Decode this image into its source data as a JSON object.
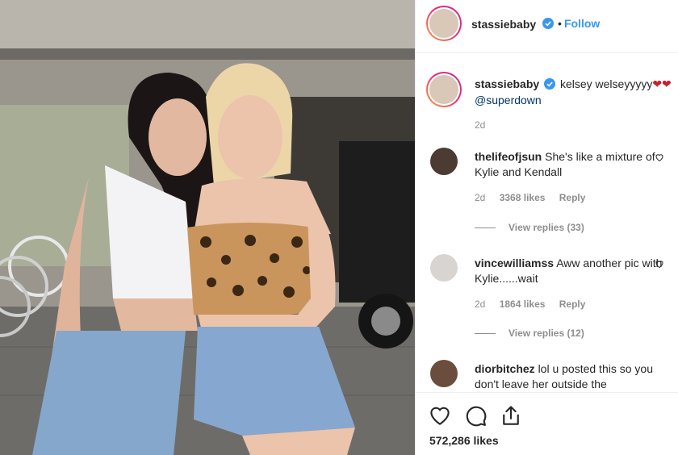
{
  "post": {
    "author": "stassiebaby",
    "follow_label": "Follow",
    "separator": "•",
    "caption": {
      "author": "stassiebaby",
      "text": "kelsey welseyyyyy",
      "hearts": "❤❤",
      "mention": "@superdown",
      "time": "2d"
    },
    "likes": "572,286 likes"
  },
  "comments": [
    {
      "user": "thelifeofjsun",
      "text": "She's like a mixture of Kylie and Kendall",
      "time": "2d",
      "likes": "3368 likes",
      "reply": "Reply",
      "view_replies": "View replies (33)"
    },
    {
      "user": "vincewilliamss",
      "text": "Aww another pic with Kylie......wait",
      "time": "2d",
      "likes": "1864 likes",
      "reply": "Reply",
      "view_replies": "View replies (12)"
    },
    {
      "user": "diorbitchez",
      "text": "lol u posted this so you don't leave her outside the"
    }
  ],
  "colors": {
    "link": "#3897f0",
    "mention": "#003569",
    "muted": "#8e8e8e",
    "verified": "#3897f0",
    "heart": "#c8202e"
  },
  "icons": [
    "verified-icon",
    "heart-icon",
    "comment-icon",
    "share-icon"
  ]
}
